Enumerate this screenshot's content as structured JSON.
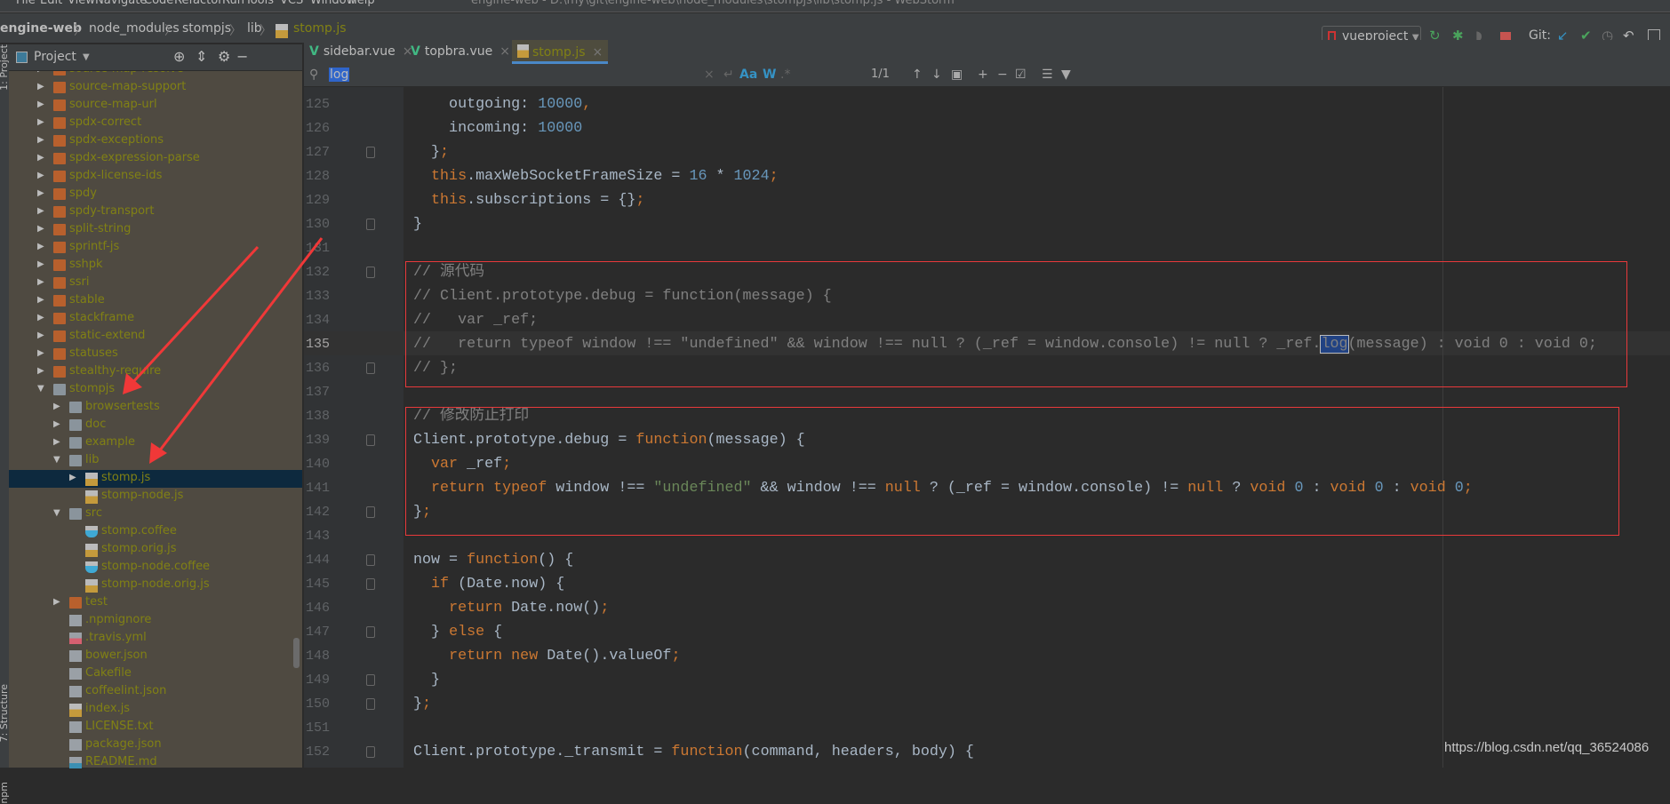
{
  "window": {
    "title": "engine-web - D:\\my\\git\\engine-web\\node_modules\\stompjs\\lib\\stomp.js - WebStorm",
    "menu": [
      "File",
      "Edit",
      "View",
      "Navigate",
      "Code",
      "Refactor",
      "Run",
      "Tools",
      "VCS",
      "Window",
      "Help"
    ]
  },
  "breadcrumb": [
    "engine-web",
    "node_modules",
    "stompjs",
    "lib",
    "stomp.js"
  ],
  "toolbar": {
    "run_config": "vueproject",
    "git_label": "Git:"
  },
  "tool_strip": {
    "project": "1: Project",
    "structure": "7: Structure",
    "npm": "npm"
  },
  "project_panel": {
    "title": "Project",
    "items": [
      {
        "label": "source-map-resolve",
        "level": 0,
        "icon": "folder-orange",
        "arrow": "collapsed"
      },
      {
        "label": "source-map-support",
        "level": 0,
        "icon": "folder-orange",
        "arrow": "collapsed"
      },
      {
        "label": "source-map-url",
        "level": 0,
        "icon": "folder-orange",
        "arrow": "collapsed"
      },
      {
        "label": "spdx-correct",
        "level": 0,
        "icon": "folder-orange",
        "arrow": "collapsed"
      },
      {
        "label": "spdx-exceptions",
        "level": 0,
        "icon": "folder-orange",
        "arrow": "collapsed"
      },
      {
        "label": "spdx-expression-parse",
        "level": 0,
        "icon": "folder-orange",
        "arrow": "collapsed"
      },
      {
        "label": "spdx-license-ids",
        "level": 0,
        "icon": "folder-orange",
        "arrow": "collapsed"
      },
      {
        "label": "spdy",
        "level": 0,
        "icon": "folder-orange",
        "arrow": "collapsed"
      },
      {
        "label": "spdy-transport",
        "level": 0,
        "icon": "folder-orange",
        "arrow": "collapsed"
      },
      {
        "label": "split-string",
        "level": 0,
        "icon": "folder-orange",
        "arrow": "collapsed"
      },
      {
        "label": "sprintf-js",
        "level": 0,
        "icon": "folder-orange",
        "arrow": "collapsed"
      },
      {
        "label": "sshpk",
        "level": 0,
        "icon": "folder-orange",
        "arrow": "collapsed"
      },
      {
        "label": "ssri",
        "level": 0,
        "icon": "folder-orange",
        "arrow": "collapsed"
      },
      {
        "label": "stable",
        "level": 0,
        "icon": "folder-orange",
        "arrow": "collapsed"
      },
      {
        "label": "stackframe",
        "level": 0,
        "icon": "folder-orange",
        "arrow": "collapsed"
      },
      {
        "label": "static-extend",
        "level": 0,
        "icon": "folder-orange",
        "arrow": "collapsed"
      },
      {
        "label": "statuses",
        "level": 0,
        "icon": "folder-orange",
        "arrow": "collapsed"
      },
      {
        "label": "stealthy-require",
        "level": 0,
        "icon": "folder-orange",
        "arrow": "collapsed"
      },
      {
        "label": "stompjs",
        "level": 0,
        "icon": "folder-gray",
        "arrow": "expanded"
      },
      {
        "label": "browsertests",
        "level": 1,
        "icon": "folder-gray",
        "arrow": "collapsed"
      },
      {
        "label": "doc",
        "level": 1,
        "icon": "folder-gray",
        "arrow": "collapsed"
      },
      {
        "label": "example",
        "level": 1,
        "icon": "folder-gray",
        "arrow": "collapsed"
      },
      {
        "label": "lib",
        "level": 1,
        "icon": "folder-gray",
        "arrow": "expanded"
      },
      {
        "label": "stomp.js",
        "level": 2,
        "icon": "js",
        "arrow": "collapsed",
        "selected": true
      },
      {
        "label": "stomp-node.js",
        "level": 2,
        "icon": "js"
      },
      {
        "label": "src",
        "level": 1,
        "icon": "folder-gray",
        "arrow": "expanded"
      },
      {
        "label": "stomp.coffee",
        "level": 2,
        "icon": "coffee"
      },
      {
        "label": "stomp.orig.js",
        "level": 2,
        "icon": "js"
      },
      {
        "label": "stomp-node.coffee",
        "level": 2,
        "icon": "coffee"
      },
      {
        "label": "stomp-node.orig.js",
        "level": 2,
        "icon": "js"
      },
      {
        "label": "test",
        "level": 1,
        "icon": "folder-orange",
        "arrow": "collapsed"
      },
      {
        "label": ".npmignore",
        "level": 1,
        "icon": "text"
      },
      {
        "label": ".travis.yml",
        "level": 1,
        "icon": "yml"
      },
      {
        "label": "bower.json",
        "level": 1,
        "icon": "json"
      },
      {
        "label": "Cakefile",
        "level": 1,
        "icon": "text"
      },
      {
        "label": "coffeelint.json",
        "level": 1,
        "icon": "json"
      },
      {
        "label": "index.js",
        "level": 1,
        "icon": "js"
      },
      {
        "label": "LICENSE.txt",
        "level": 1,
        "icon": "text"
      },
      {
        "label": "package.json",
        "level": 1,
        "icon": "json"
      },
      {
        "label": "README.md",
        "level": 1,
        "icon": "md"
      }
    ]
  },
  "tabs": [
    {
      "label": "sidebar.vue",
      "icon": "vue-icon"
    },
    {
      "label": "topbra.vue",
      "icon": "vue-icon"
    },
    {
      "label": "stomp.js",
      "icon": "js-icon",
      "active": true
    }
  ],
  "find": {
    "query": "log",
    "match_count": "1/1",
    "match_case": "Aa",
    "words": "W",
    "regex": ".*"
  },
  "editor": {
    "current_line": 135,
    "lines": [
      {
        "n": 125,
        "t": [
          [
            "p",
            "    outgoing: "
          ],
          [
            "n",
            "10000"
          ],
          [
            "k",
            ","
          ]
        ]
      },
      {
        "n": 126,
        "t": [
          [
            "p",
            "    incoming: "
          ],
          [
            "n",
            "10000"
          ]
        ]
      },
      {
        "n": 127,
        "t": [
          [
            "p",
            "  }"
          ],
          [
            "k",
            ";"
          ]
        ],
        "fold": true
      },
      {
        "n": 128,
        "t": [
          [
            "p",
            "  "
          ],
          [
            "k",
            "this"
          ],
          [
            "p",
            ".maxWebSocketFrameSize = "
          ],
          [
            "n",
            "16"
          ],
          [
            "p",
            " * "
          ],
          [
            "n",
            "1024"
          ],
          [
            "k",
            ";"
          ]
        ]
      },
      {
        "n": 129,
        "t": [
          [
            "p",
            "  "
          ],
          [
            "k",
            "this"
          ],
          [
            "p",
            ".subscriptions = {}"
          ],
          [
            "k",
            ";"
          ]
        ]
      },
      {
        "n": 130,
        "t": [
          [
            "p",
            "}"
          ]
        ],
        "fold": true
      },
      {
        "n": 131,
        "t": []
      },
      {
        "n": 132,
        "t": [
          [
            "c",
            "// 源代码"
          ]
        ],
        "fold": true
      },
      {
        "n": 133,
        "t": [
          [
            "c",
            "// Client.prototype.debug = function(message) {"
          ]
        ]
      },
      {
        "n": 134,
        "t": [
          [
            "c",
            "//   var _ref;"
          ]
        ]
      },
      {
        "n": 135,
        "t": [
          [
            "c",
            "//   return typeof window !== \"undefined\" && window !== null ? (_ref = window.console) != null ? _ref."
          ],
          [
            "h",
            "log"
          ],
          [
            "c",
            "(message) : void 0 : void 0;"
          ]
        ]
      },
      {
        "n": 136,
        "t": [
          [
            "c",
            "// };"
          ]
        ],
        "fold": true
      },
      {
        "n": 137,
        "t": []
      },
      {
        "n": 138,
        "t": [
          [
            "c",
            "// 修改防止打印"
          ]
        ]
      },
      {
        "n": 139,
        "t": [
          [
            "p",
            "Client.prototype.debug = "
          ],
          [
            "k",
            "function"
          ],
          [
            "p",
            "(message) {"
          ]
        ],
        "fold": true
      },
      {
        "n": 140,
        "t": [
          [
            "p",
            "  "
          ],
          [
            "k",
            "var"
          ],
          [
            "p",
            " _ref"
          ],
          [
            "k",
            ";"
          ]
        ]
      },
      {
        "n": 141,
        "t": [
          [
            "p",
            "  "
          ],
          [
            "k",
            "return typeof"
          ],
          [
            "p",
            " window !== "
          ],
          [
            "s",
            "\"undefined\""
          ],
          [
            "p",
            " && window !== "
          ],
          [
            "k",
            "null"
          ],
          [
            "p",
            " ? (_ref = window.console) != "
          ],
          [
            "k",
            "null"
          ],
          [
            "p",
            " ? "
          ],
          [
            "k",
            "void"
          ],
          [
            "p",
            " "
          ],
          [
            "n",
            "0"
          ],
          [
            "p",
            " : "
          ],
          [
            "k",
            "void"
          ],
          [
            "p",
            " "
          ],
          [
            "n",
            "0"
          ],
          [
            "p",
            " : "
          ],
          [
            "k",
            "void"
          ],
          [
            "p",
            " "
          ],
          [
            "n",
            "0"
          ],
          [
            "k",
            ";"
          ]
        ]
      },
      {
        "n": 142,
        "t": [
          [
            "p",
            "}"
          ],
          [
            "k",
            ";"
          ]
        ],
        "fold": true
      },
      {
        "n": 143,
        "t": []
      },
      {
        "n": 144,
        "t": [
          [
            "p",
            "now = "
          ],
          [
            "k",
            "function"
          ],
          [
            "p",
            "() {"
          ]
        ],
        "fold": true
      },
      {
        "n": 145,
        "t": [
          [
            "p",
            "  "
          ],
          [
            "k",
            "if"
          ],
          [
            "p",
            " (Date.now) {"
          ]
        ],
        "fold": true
      },
      {
        "n": 146,
        "t": [
          [
            "p",
            "    "
          ],
          [
            "k",
            "return"
          ],
          [
            "p",
            " Date.now()"
          ],
          [
            "k",
            ";"
          ]
        ]
      },
      {
        "n": 147,
        "t": [
          [
            "p",
            "  } "
          ],
          [
            "k",
            "else"
          ],
          [
            "p",
            " {"
          ]
        ],
        "fold": true
      },
      {
        "n": 148,
        "t": [
          [
            "p",
            "    "
          ],
          [
            "k",
            "return new"
          ],
          [
            "p",
            " Date().valueOf"
          ],
          [
            "k",
            ";"
          ]
        ]
      },
      {
        "n": 149,
        "t": [
          [
            "p",
            "  }"
          ]
        ],
        "fold": true
      },
      {
        "n": 150,
        "t": [
          [
            "p",
            "}"
          ],
          [
            "k",
            ";"
          ]
        ],
        "fold": true
      },
      {
        "n": 151,
        "t": []
      },
      {
        "n": 152,
        "t": [
          [
            "p",
            "Client.prototype._transmit = "
          ],
          [
            "k",
            "function"
          ],
          [
            "p",
            "(command, headers, body) {"
          ]
        ],
        "fold": true
      }
    ]
  },
  "watermark": "https://blog.csdn.net/qq_36524086",
  "colors": {
    "annotation": "#e8393b",
    "keyword": "#cc7832",
    "number": "#6897bb",
    "string": "#6a8759",
    "comment": "#808080",
    "tree_text": "#818114",
    "tree_bg": "#4f4a41"
  }
}
